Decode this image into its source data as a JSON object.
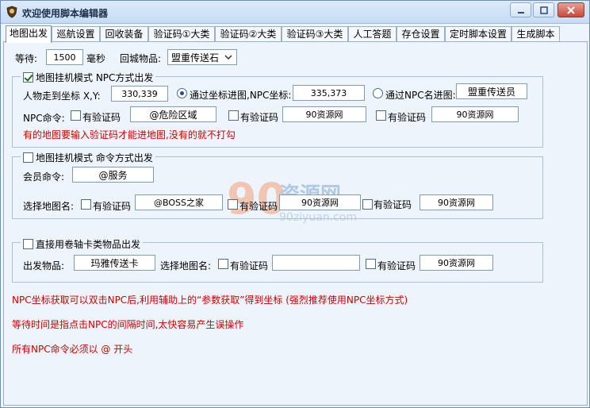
{
  "window": {
    "title": "欢迎使用脚本编辑器"
  },
  "tabs": [
    {
      "label": "地图出发"
    },
    {
      "label": "巡航设置"
    },
    {
      "label": "回收装备"
    },
    {
      "label": "验证码①大类"
    },
    {
      "label": "验证码②大类"
    },
    {
      "label": "验证码③大类"
    },
    {
      "label": "人工答题"
    },
    {
      "label": "存仓设置"
    },
    {
      "label": "定时脚本设置"
    },
    {
      "label": "生成脚本"
    }
  ],
  "top": {
    "wait_label": "等待:",
    "wait_value": "1500",
    "wait_unit": "毫秒",
    "return_item_label": "回城物品:",
    "return_item_value": "盟重传送石"
  },
  "group1": {
    "title": "地图挂机模式  NPC方式出发",
    "coord_label": "人物走到坐标 X,Y:",
    "coord_value": "330,339",
    "via_coord_label": "通过坐标进图,NPC坐标:",
    "npc_coord_value": "335,373",
    "via_name_label": "通过NPC名进图:",
    "npc_name_value": "盟重传送员",
    "npc_cmd_label": "NPC命令:",
    "verify_label": "有验证码",
    "cmd_value": "@危险区域",
    "verify2_value": "90资源网",
    "verify3_value": "90资源网",
    "note": "有的地图要输入验证码才能进地图,没有的就不打勾"
  },
  "group2": {
    "title": "地图挂机模式  命令方式出发",
    "member_cmd_label": "会员命令:",
    "member_cmd_value": "@服务",
    "map_name_label": "选择地图名:",
    "verify_label": "有验证码",
    "map_value": "@BOSS之家",
    "verify2_value": "90资源网",
    "verify3_value": "90资源网"
  },
  "group3": {
    "title": "直接用卷轴卡类物品出发",
    "item_label": "出发物品:",
    "item_value": "玛雅传送卡",
    "map_name_label": "选择地图名:",
    "verify_label": "有验证码",
    "map_value": "",
    "verify2_value": "90资源网"
  },
  "notes": [
    "NPC坐标获取可以双击NPC后,利用辅助上的“参数获取”得到坐标 (强烈推荐使用NPC坐标方式)",
    "等待时间是指点击NPC的间隔时间,太快容易产生误操作",
    "所有NPC命令必须以 @ 开头"
  ],
  "watermark": {
    "big": "90",
    "cn": "资源网",
    "url": "90ziyuan.com"
  }
}
